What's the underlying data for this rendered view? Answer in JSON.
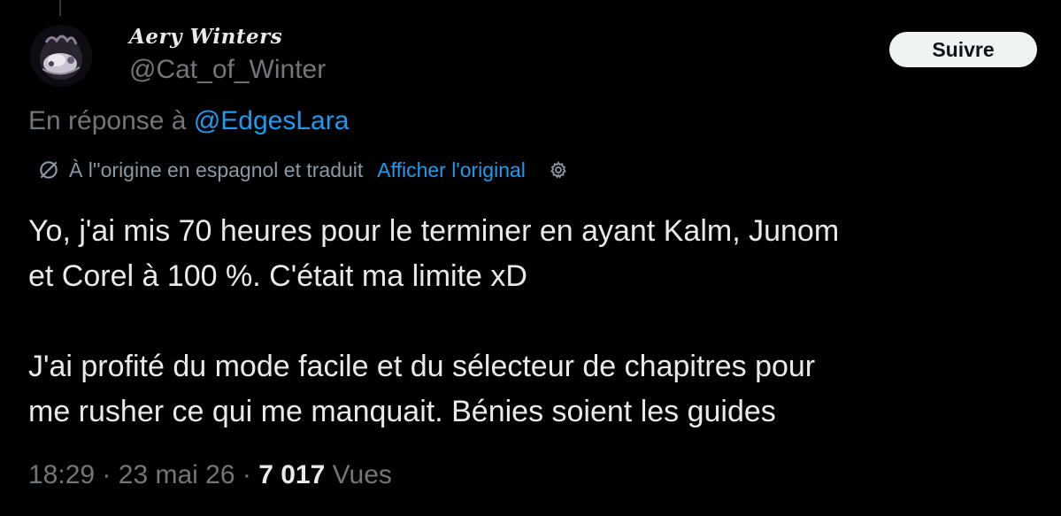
{
  "author": {
    "display_name": "Aery Winters",
    "handle": "@Cat_of_Winter"
  },
  "actions": {
    "follow_label": "Suivre"
  },
  "reply": {
    "prefix": "En réponse à",
    "mention": "@EdgesLara"
  },
  "translation": {
    "note": "À l''origine en espagnol et traduit",
    "show_original_label": "Afficher l'original",
    "icons": [
      "translate-icon",
      "gear-icon"
    ]
  },
  "tweet": {
    "lines": [
      "Yo, j'ai mis 70 heures pour le terminer en ayant Kalm, Junom",
      "et Corel à 100 %. C'était ma limite xD",
      "J'ai profité du mode facile et du sélecteur de chapitres pour",
      "me rusher ce qui me manquait. Bénies soient les guides"
    ]
  },
  "meta": {
    "time": "18:29",
    "date": "23 mai 26",
    "separator": "·",
    "views_count": "7 017",
    "views_label": "Vues"
  },
  "colors": {
    "background": "#000000",
    "text": "#e7e9ea",
    "muted": "#71767b",
    "link": "#1d9bf0",
    "button_bg": "#eff3f4"
  }
}
